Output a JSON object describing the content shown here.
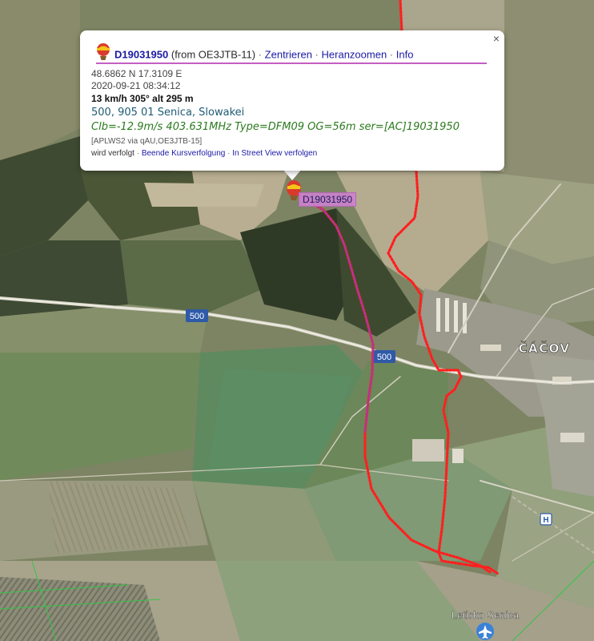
{
  "popup": {
    "callsign": "D19031950",
    "from_text": "(from OE3JTB-11)",
    "sep": "·",
    "link_center": "Zentrieren",
    "link_zoom": "Heranzoomen",
    "link_info": "Info",
    "coords": "48.6862 N 17.3109 E",
    "time": "2020-09-21 08:34:12",
    "speed_alt": "13 km/h 305° alt 295 m",
    "address": "500, 905 01 Senica, Slowakei",
    "comment": "Clb=-12.9m/s 403.631MHz Type=DFM09 OG=56m ser=[AC]19031950",
    "path": "[APLWS2 via qAU,OE3JTB-15]",
    "tracked_text": "wird verfolgt",
    "link_stop_tracking": "Beende Kursverfolgung",
    "link_streetview": "In Street View verfolgen",
    "close_symbol": "×"
  },
  "map": {
    "marker_label": "D19031950",
    "road_label": "500",
    "village_label": "ČÁČOV",
    "airport_label": "Letisko Senica",
    "bus_icon_label": "H",
    "airport_icon": "airplane-icon",
    "marker_icon": "balloon-icon",
    "track_color": "#ff2020",
    "path_color": "#8a3fd6",
    "popup_rule_color": "#c45ec1"
  }
}
